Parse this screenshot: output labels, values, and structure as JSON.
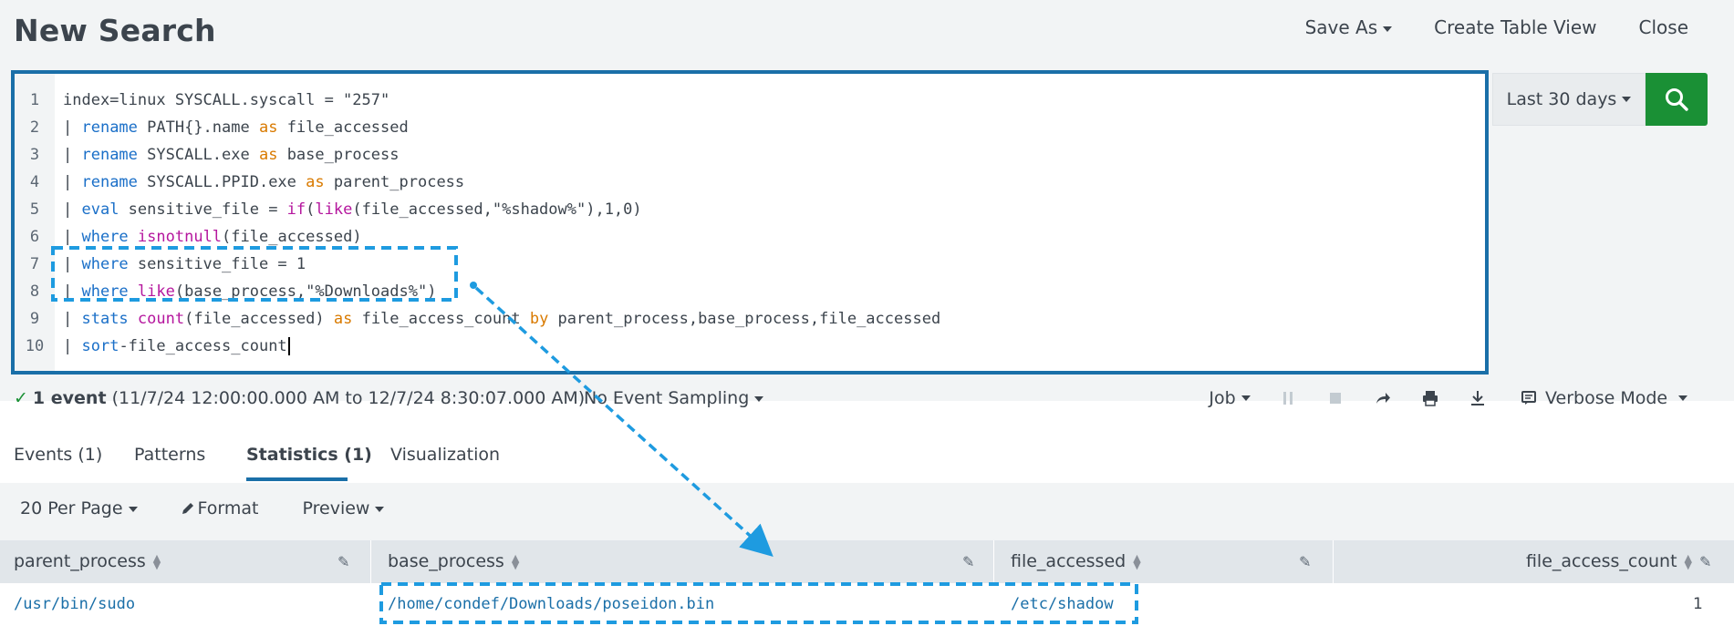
{
  "header": {
    "title": "New Search",
    "save_as": "Save As",
    "create_table_view": "Create Table View",
    "close": "Close"
  },
  "editor": {
    "lines": [
      {
        "n": "1",
        "parts": [
          [
            "",
            "index=linux SYSCALL.syscall = \"257\""
          ]
        ]
      },
      {
        "n": "2",
        "parts": [
          [
            "",
            "| "
          ],
          [
            "kw",
            "rename"
          ],
          [
            "",
            " PATH{}.name "
          ],
          [
            "op",
            "as"
          ],
          [
            "",
            " file_accessed"
          ]
        ]
      },
      {
        "n": "3",
        "parts": [
          [
            "",
            "| "
          ],
          [
            "kw",
            "rename"
          ],
          [
            "",
            " SYSCALL.exe "
          ],
          [
            "op",
            "as"
          ],
          [
            "",
            " base_process"
          ]
        ]
      },
      {
        "n": "4",
        "parts": [
          [
            "",
            "| "
          ],
          [
            "kw",
            "rename"
          ],
          [
            "",
            " SYSCALL.PPID.exe "
          ],
          [
            "op",
            "as"
          ],
          [
            "",
            " parent_process"
          ]
        ]
      },
      {
        "n": "5",
        "parts": [
          [
            "",
            "| "
          ],
          [
            "kw",
            "eval"
          ],
          [
            "",
            " sensitive_file = "
          ],
          [
            "fn",
            "if"
          ],
          [
            "",
            "("
          ],
          [
            "fn",
            "like"
          ],
          [
            "",
            "(file_accessed,\"%shadow%\"),1,0)"
          ]
        ]
      },
      {
        "n": "6",
        "parts": [
          [
            "",
            "| "
          ],
          [
            "kw",
            "where"
          ],
          [
            "",
            " "
          ],
          [
            "fn",
            "isnotnull"
          ],
          [
            "",
            "(file_accessed)"
          ]
        ]
      },
      {
        "n": "7",
        "parts": [
          [
            "",
            "| "
          ],
          [
            "kw",
            "where"
          ],
          [
            "",
            " sensitive_file = 1"
          ]
        ]
      },
      {
        "n": "8",
        "parts": [
          [
            "",
            "| "
          ],
          [
            "kw",
            "where"
          ],
          [
            "",
            " "
          ],
          [
            "fn",
            "like"
          ],
          [
            "",
            "(base_process,\"%Downloads%\")"
          ]
        ]
      },
      {
        "n": "9",
        "parts": [
          [
            "",
            "| "
          ],
          [
            "kw",
            "stats"
          ],
          [
            "",
            " "
          ],
          [
            "fn",
            "count"
          ],
          [
            "",
            "(file_accessed) "
          ],
          [
            "op",
            "as"
          ],
          [
            "",
            " file_access_count "
          ],
          [
            "op",
            "by"
          ],
          [
            "",
            " parent_process,base_process,file_accessed"
          ]
        ]
      },
      {
        "n": "10",
        "parts": [
          [
            "",
            "| "
          ],
          [
            "kw",
            "sort"
          ],
          [
            "",
            "-file_access_count"
          ]
        ]
      }
    ]
  },
  "time_picker": {
    "label": "Last 30 days"
  },
  "status": {
    "count": "1 event",
    "range": "(11/7/24 12:00:00.000 AM to 12/7/24 8:30:07.000 AM)",
    "sampling": "No Event Sampling",
    "job": "Job",
    "mode": "Verbose Mode"
  },
  "tabs": [
    {
      "label": "Events (1)"
    },
    {
      "label": "Patterns"
    },
    {
      "label": "Statistics (1)"
    },
    {
      "label": "Visualization"
    }
  ],
  "toolbar": {
    "per_page": "20 Per Page",
    "format": "Format",
    "preview": "Preview"
  },
  "table": {
    "columns": [
      "parent_process",
      "base_process",
      "file_accessed",
      "file_access_count"
    ],
    "rows": [
      [
        "/usr/bin/sudo",
        "/home/condef/Downloads/poseidon.bin",
        "/etc/shadow",
        "1"
      ]
    ]
  },
  "colors": {
    "accent": "#1a6fa8",
    "search_button": "#1a9035",
    "annotation": "#1e9be0"
  }
}
